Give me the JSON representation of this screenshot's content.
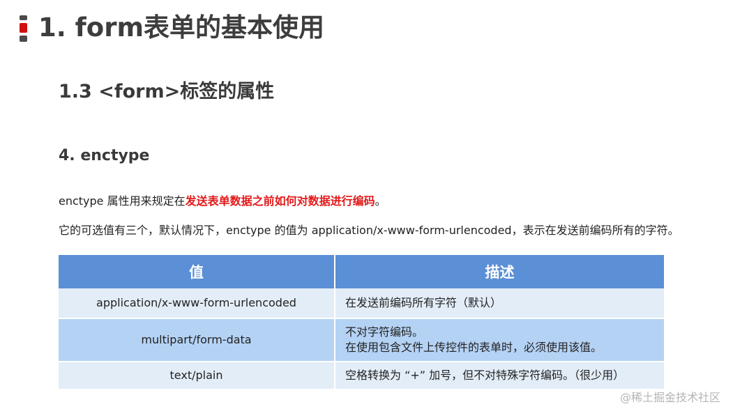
{
  "header": {
    "title": "1. form表单的基本使用"
  },
  "subtitle": "1.3 <form>标签的属性",
  "section": {
    "heading": "4. enctype"
  },
  "paragraph1": {
    "before": "enctype 属性用来规定在",
    "highlight": "发送表单数据之前如何对数据进行编码",
    "after": "。"
  },
  "paragraph2": "它的可选值有三个，默认情况下，enctype 的值为 application/x-www-form-urlencoded，表示在发送前编码所有的字符。",
  "table": {
    "headers": [
      "值",
      "描述"
    ],
    "rows": [
      {
        "value": "application/x-www-form-urlencoded",
        "desc": [
          "在发送前编码所有字符（默认）"
        ]
      },
      {
        "value": "multipart/form-data",
        "desc": [
          "不对字符编码。",
          "在使用包含文件上传控件的表单时，必须使用该值。"
        ]
      },
      {
        "value": "text/plain",
        "desc": [
          "空格转换为 “+” 加号，但不对特殊字符编码。（很少用）"
        ]
      }
    ]
  },
  "watermark": "@稀土掘金技术社区",
  "colors": {
    "accent_red": "#e21a1a",
    "table_header": "#5b8fd6",
    "row_light": "#e3edf8",
    "row_dark": "#b4d2f4"
  }
}
